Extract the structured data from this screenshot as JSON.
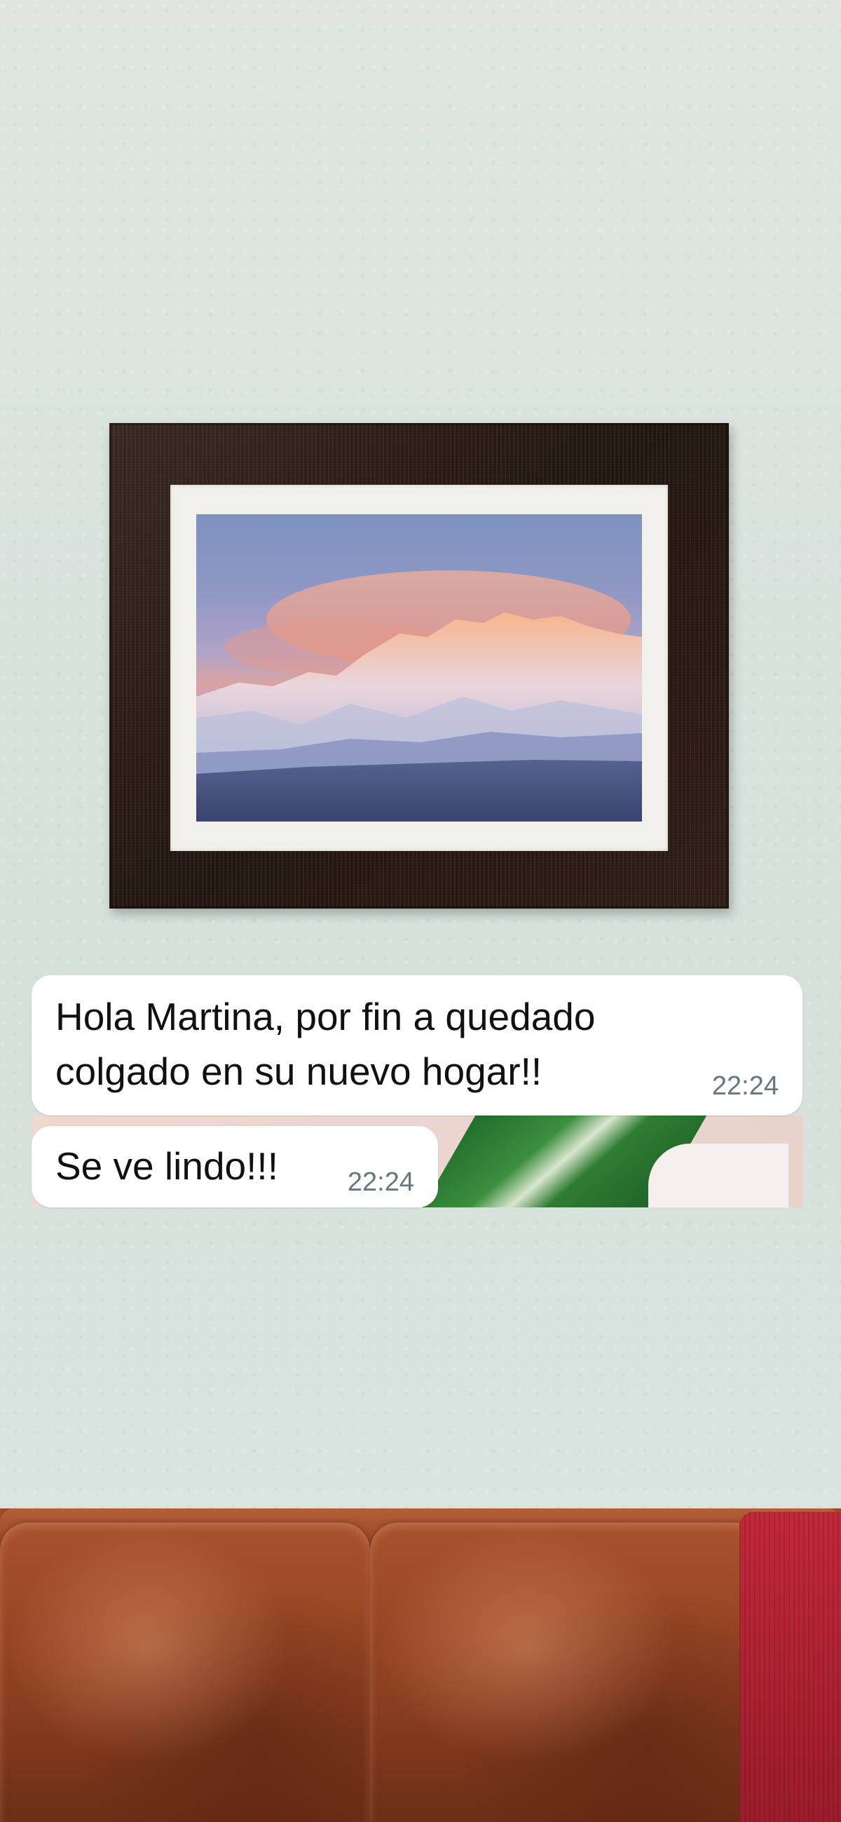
{
  "chat": {
    "messages": [
      {
        "text": "Hola Martina, por fin a quedado colgado en su nuevo hogar!!",
        "time": "22:24"
      },
      {
        "text": "Se ve lindo!!!",
        "time": "22:24"
      }
    ]
  },
  "colors": {
    "bubble": "#ffffff",
    "time_text": "#667781",
    "frame": "#2b1c14",
    "wall": "#d8e2dd",
    "sofa": "#8a3f22"
  }
}
